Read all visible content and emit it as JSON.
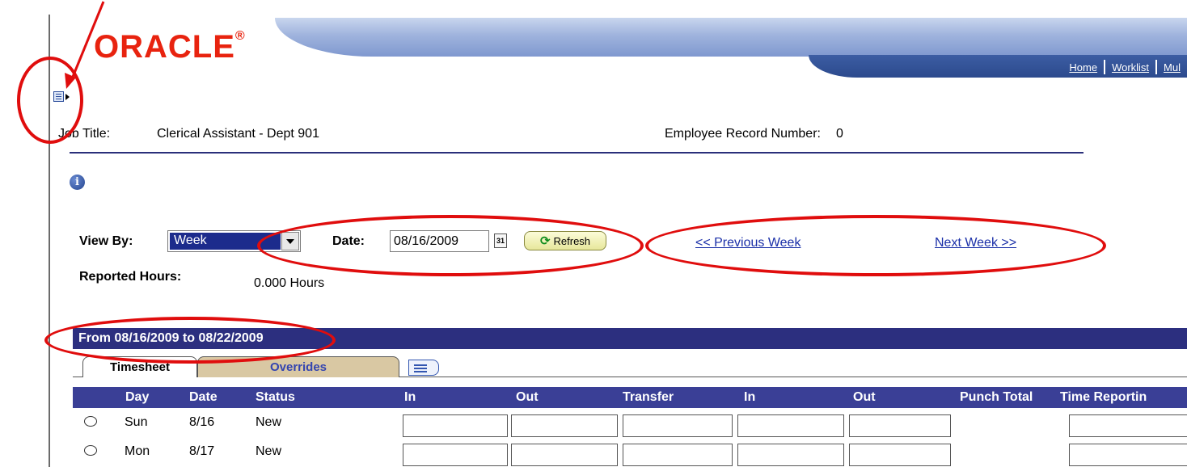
{
  "header": {
    "logo_text": "ORACLE",
    "logo_mark": "®",
    "nav_links": [
      "Home",
      "Worklist",
      "Mul"
    ]
  },
  "employee": {
    "job_title_label": "Job Title:",
    "job_title_value": "Clerical Assistant - Dept 901",
    "record_number_label": "Employee Record Number:",
    "record_number_value": "0"
  },
  "filters": {
    "view_by_label": "View By:",
    "view_by_value": "Week",
    "date_label": "Date:",
    "date_value": "08/16/2009",
    "calendar_icon_text": "31",
    "refresh_label": "Refresh",
    "previous_week_label": "<< Previous Week",
    "next_week_label": "Next Week >>",
    "reported_hours_label": "Reported Hours:",
    "reported_hours_value": "0.000 Hours"
  },
  "period": {
    "date_range": "From 08/16/2009 to 08/22/2009"
  },
  "tabs": [
    "Timesheet",
    "Overrides"
  ],
  "grid": {
    "columns": [
      "Day",
      "Date",
      "Status",
      "In",
      "Out",
      "Transfer",
      "In",
      "Out",
      "Punch Total",
      "Time Reportin"
    ],
    "rows": [
      {
        "day": "Sun",
        "date": "8/16",
        "status": "New"
      },
      {
        "day": "Mon",
        "date": "8/17",
        "status": "New"
      }
    ]
  },
  "colors": {
    "oracle_red": "#e8230f",
    "band_navy": "#2c2f7f",
    "grid_header": "#3a3f96",
    "link_blue": "#1a2fa8",
    "annotation_red": "#e00d0d"
  }
}
